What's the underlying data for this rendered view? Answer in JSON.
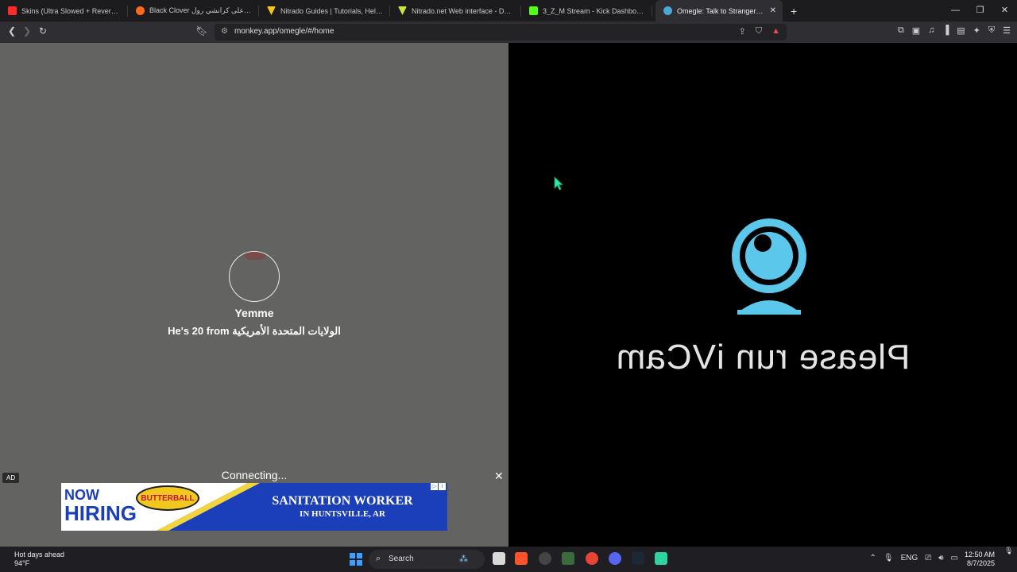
{
  "browser": {
    "tabs": [
      {
        "title": "Skins (Ultra Slowed + Reverb) - YouTube",
        "favicon_color": "#ff2b2b"
      },
      {
        "title": "Black Clover شاهد على كرانشي رول - ...",
        "favicon_color": "#ff6a1a"
      },
      {
        "title": "Nitrado Guides | Tutorials, Help & More",
        "favicon_color": "#f5c518"
      },
      {
        "title": "Nitrado.net Web interface - Dashboard",
        "favicon_color": "#c6e83c"
      },
      {
        "title": "3_Z_M Stream - Kick Dashboard",
        "favicon_color": "#53fc18"
      },
      {
        "title": "Omegle: Talk to Strangers with",
        "favicon_color": "#4aa8d8",
        "active": true
      }
    ],
    "new_tab_label": "+",
    "url": "monkey.app/omegle/#/home"
  },
  "left_pane": {
    "username": "Yemme",
    "info": "He's 20 from الولايات المتحدة الأمريكية",
    "status": "Connecting..."
  },
  "ad": {
    "tag": "AD",
    "close": "✕",
    "headline_1": "NOW",
    "headline_2": "HIRING",
    "brand": "BUTTERBALL",
    "job": "SANITATION WORKER",
    "location": "IN HUNTSVILLE, AR"
  },
  "right_pane": {
    "message": "Please run iVCam"
  },
  "taskbar": {
    "weather_title": "Hot days ahead",
    "weather_temp": "94°F",
    "search_label": "Search",
    "language": "ENG",
    "time": "12:50 AM",
    "date": "8/7/2025"
  }
}
